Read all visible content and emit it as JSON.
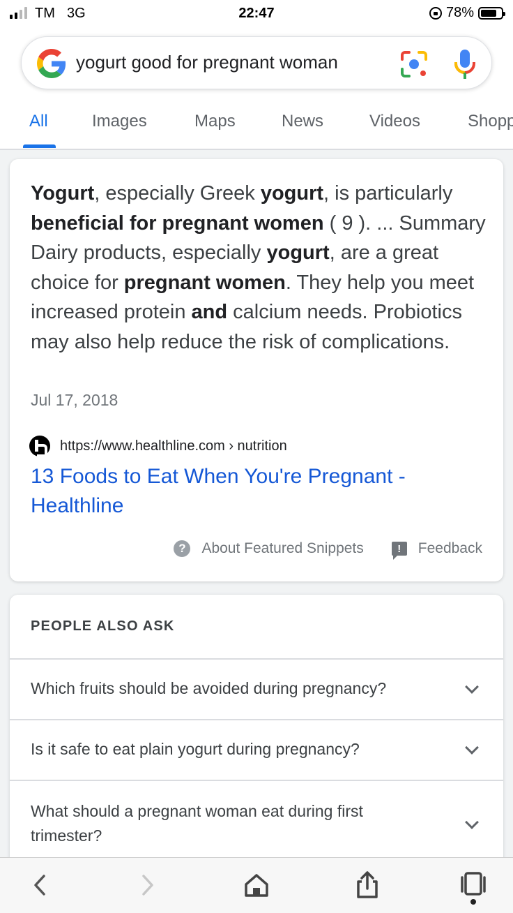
{
  "status_bar": {
    "carrier": "TM",
    "network": "3G",
    "time": "22:47",
    "battery": "78%",
    "battery_level": 0.78
  },
  "search": {
    "query": "yogurt good for pregnant woman"
  },
  "tabs": [
    {
      "label": "All",
      "active": true
    },
    {
      "label": "Images",
      "active": false
    },
    {
      "label": "Maps",
      "active": false
    },
    {
      "label": "News",
      "active": false
    },
    {
      "label": "Videos",
      "active": false
    },
    {
      "label": "Shopp",
      "active": false
    }
  ],
  "snippet": {
    "segments": [
      {
        "text": "Yogurt",
        "bold": true
      },
      {
        "text": ", especially Greek ",
        "bold": false
      },
      {
        "text": "yogurt",
        "bold": true
      },
      {
        "text": ", is particularly ",
        "bold": false
      },
      {
        "text": "beneficial for pregnant women",
        "bold": true
      },
      {
        "text": " ( 9 ). ... Summary Dairy products, especially ",
        "bold": false
      },
      {
        "text": "yogurt",
        "bold": true
      },
      {
        "text": ", are a great choice for ",
        "bold": false
      },
      {
        "text": "pregnant women",
        "bold": true
      },
      {
        "text": ". They help you meet increased protein ",
        "bold": false
      },
      {
        "text": "and",
        "bold": true
      },
      {
        "text": " calcium needs. Probiotics may also help reduce the risk of complications.",
        "bold": false
      }
    ],
    "date": "Jul 17, 2018",
    "source_url": "https://www.healthline.com › nutrition",
    "title": "13 Foods to Eat When You're Pregnant - Healthline",
    "about_label": "About Featured Snippets",
    "feedback_label": "Feedback",
    "help_glyph": "?",
    "feedback_glyph": "!"
  },
  "paa": {
    "title": "PEOPLE ALSO ASK",
    "questions": [
      "Which fruits should be avoided during pregnancy?",
      "Is it safe to eat plain yogurt during pregnancy?",
      "What should a pregnant woman eat during first trimester?"
    ]
  },
  "toolbar": {
    "icons": [
      "back-icon",
      "forward-icon",
      "home-icon",
      "share-icon",
      "tabs-icon"
    ]
  },
  "colors": {
    "accent": "#1a73e8",
    "link": "#1558d6"
  }
}
